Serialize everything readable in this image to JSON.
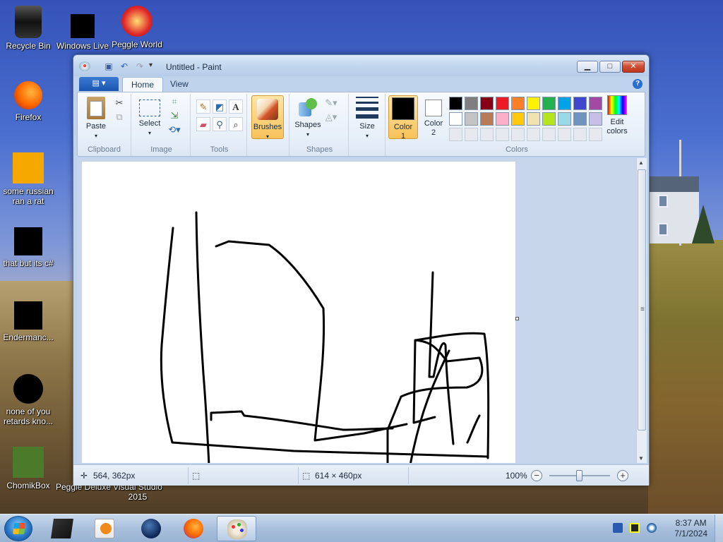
{
  "desktop": {
    "icons": [
      {
        "label": "Recycle Bin"
      },
      {
        "label": "Windows Live"
      },
      {
        "label": "Peggle World"
      },
      {
        "label": "Firefox"
      },
      {
        "label": "some russian ran a rat"
      },
      {
        "label": "that but its c#"
      },
      {
        "label": "Endermanc..."
      },
      {
        "label": "none of you retards kno..."
      },
      {
        "label": "ChomikBox"
      },
      {
        "label": "Peggle Deluxe"
      },
      {
        "label": "Visual Studio 2015"
      }
    ]
  },
  "window": {
    "title": "Untitled - Paint",
    "buttons": {
      "minimize": "▁",
      "maximize": "□",
      "close": "✕"
    }
  },
  "ribbon": {
    "file_tab": "▤ ▾",
    "tabs": [
      {
        "label": "Home"
      },
      {
        "label": "View"
      }
    ],
    "groups": {
      "clipboard": {
        "label": "Clipboard",
        "paste": "Paste"
      },
      "image": {
        "label": "Image",
        "select": "Select"
      },
      "tools": {
        "label": "Tools"
      },
      "brushes": {
        "label": "Brushes"
      },
      "shapes": {
        "label": "Shapes",
        "shapes_btn": "Shapes"
      },
      "size": {
        "label": "Size"
      },
      "colors": {
        "label": "Colors",
        "color1_label": "Color",
        "color1_num": "1",
        "color2_label": "Color",
        "color2_num": "2",
        "edit_colors": "Edit colors",
        "palette_row1": [
          "#000000",
          "#7f7f7f",
          "#880015",
          "#ed1c24",
          "#ff7f27",
          "#fff200",
          "#22b14c",
          "#00a2e8",
          "#3f48cc",
          "#a349a4"
        ],
        "palette_row2": [
          "#ffffff",
          "#c3c3c3",
          "#b97a57",
          "#ffaec9",
          "#ffc90e",
          "#efe4b0",
          "#b5e61d",
          "#99d9ea",
          "#7092be",
          "#c8bfe7"
        ],
        "color1": "#000000",
        "color2": "#ffffff"
      }
    }
  },
  "statusbar": {
    "cursor_pos": "564, 362px",
    "canvas_size": "614 × 460px",
    "zoom": "100%",
    "zoom_level": 1.0
  },
  "taskbar": {
    "time": "8:37 AM",
    "date": "7/1/2024"
  }
}
